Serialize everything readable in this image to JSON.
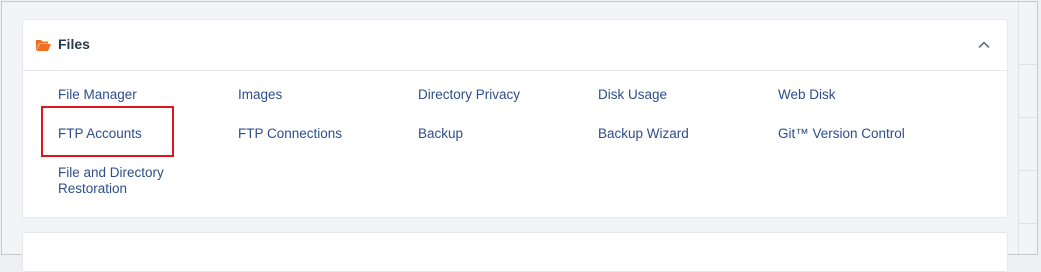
{
  "section": {
    "title": "Files"
  },
  "links": {
    "file_manager": "File Manager",
    "images": "Images",
    "directory_privacy": "Directory Privacy",
    "disk_usage": "Disk Usage",
    "web_disk": "Web Disk",
    "ftp_accounts": "FTP Accounts",
    "ftp_connections": "FTP Connections",
    "backup": "Backup",
    "backup_wizard": "Backup Wizard",
    "git_version_control": "Git™ Version Control",
    "file_dir_restoration": "File and Directory Restoration"
  },
  "icons": {
    "section_icon": "folder-open-icon",
    "collapse_icon": "chevron-up-icon"
  },
  "colors": {
    "accent_icon": "#f26f21",
    "link": "#2d4e8a",
    "highlight": "#e0141e"
  }
}
